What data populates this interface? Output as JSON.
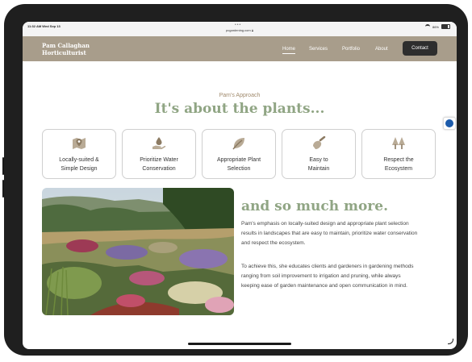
{
  "status_bar": {
    "time": "11:32 AM  Wed Sep 13",
    "url": "pcgardening.com",
    "battery": "86%"
  },
  "brand": {
    "line1": "Pam Callaghan",
    "line2": "Horticulturist"
  },
  "nav": {
    "items": [
      "Home",
      "Services",
      "Portfolio",
      "About"
    ],
    "active": "Home",
    "contact_label": "Contact"
  },
  "approach": {
    "eyebrow": "Pam's Approach",
    "headline": "It's about the plants..."
  },
  "cards": [
    {
      "icon": "map-pin-icon",
      "line1": "Locally-suited &",
      "line2": "Simple Design"
    },
    {
      "icon": "water-hand-icon",
      "line1": "Prioritize Water",
      "line2": "Conservation"
    },
    {
      "icon": "leaf-icon",
      "line1": "Appropriate Plant",
      "line2": "Selection"
    },
    {
      "icon": "trowel-icon",
      "line1": "Easy to",
      "line2": "Maintain"
    },
    {
      "icon": "trees-icon",
      "line1": "Respect the",
      "line2": "Ecosystem"
    }
  ],
  "more": {
    "headline": "and so much more.",
    "paragraph1": "Pam's emphasis on locally-suited design and appropriate plant selection results in landscapes that are easy to maintain, prioritize water conservation and respect the ecosystem.",
    "paragraph2": "To achieve this, she educates clients and gardeners in gardening methods ranging from soil improvement to irrigation and pruning, while always keeping ease of garden maintenance and open communication in mind."
  },
  "colors": {
    "nav_bg": "#a89d8b",
    "accent_green": "#90a584",
    "eyebrow": "#a08a6c",
    "button_dark": "#2e2e2e"
  }
}
